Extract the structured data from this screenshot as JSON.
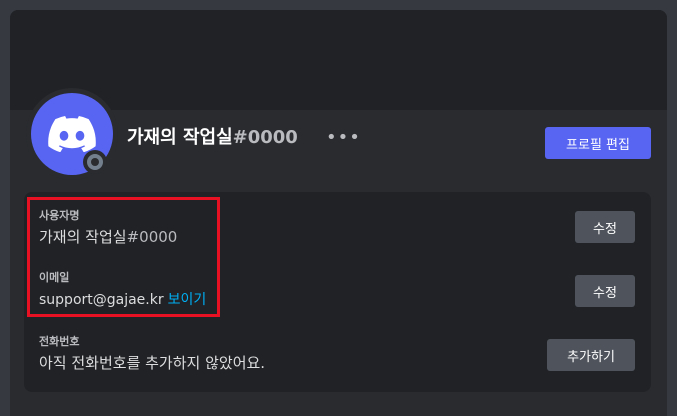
{
  "profile": {
    "display_name": "가재의 작업실",
    "tag": "#0000",
    "more_icon": "ellipsis-icon",
    "edit_profile_label": "프로필 편집",
    "avatar_icon": "discord-logo-icon",
    "status": "offline"
  },
  "fields": {
    "username": {
      "label": "사용자명",
      "value": "가재의 작업실",
      "tag": "#0000",
      "action_label": "수정"
    },
    "email": {
      "label": "이메일",
      "value": "support@gajae.kr",
      "reveal_label": "보이기",
      "action_label": "수정"
    },
    "phone": {
      "label": "전화번호",
      "value": "아직 전화번호를 추가하지 않았어요.",
      "action_label": "추가하기"
    }
  },
  "colors": {
    "brand": "#5865f2",
    "highlight": "#e81123",
    "link": "#00aff4"
  }
}
